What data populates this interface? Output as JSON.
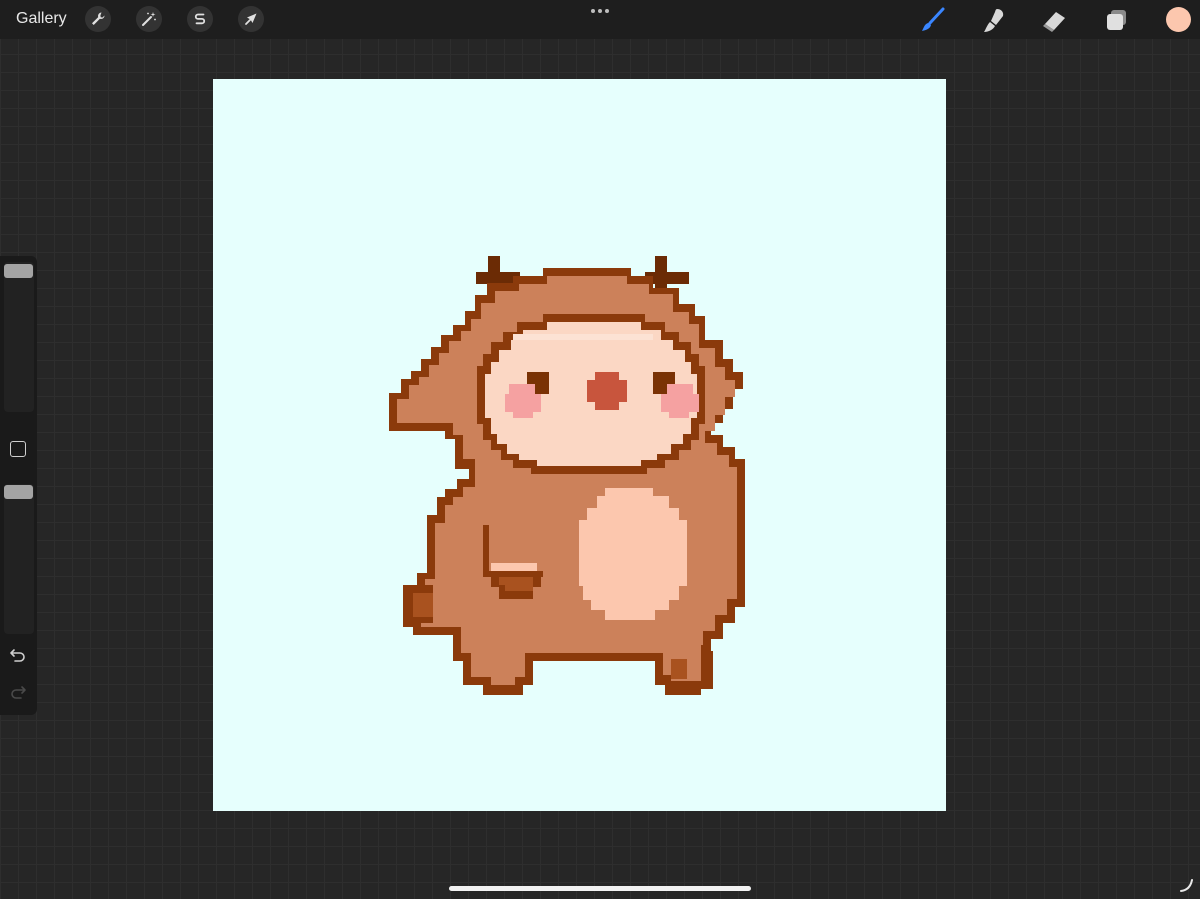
{
  "app": {
    "gallery_label": "Gallery"
  },
  "toolbar_left": [
    {
      "name": "actions",
      "icon": "wrench-icon"
    },
    {
      "name": "adjustments",
      "icon": "magic-wand-icon"
    },
    {
      "name": "selection",
      "icon": "selection-s-icon"
    },
    {
      "name": "transform",
      "icon": "arrow-cursor-icon"
    }
  ],
  "toolbar_right": [
    {
      "name": "brush",
      "icon": "brush-icon",
      "active": true
    },
    {
      "name": "smudge",
      "icon": "smudge-icon",
      "active": false
    },
    {
      "name": "eraser",
      "icon": "eraser-icon",
      "active": false
    },
    {
      "name": "layers",
      "icon": "layers-icon",
      "active": false
    }
  ],
  "colors": {
    "current_color": "#fcc7ae",
    "active_tool": "#3a86ff",
    "canvas_bg": "#e6fffd",
    "outline": "#8b3a0b",
    "fur": "#cc815a",
    "face": "#fbd7c4",
    "belly": "#fcc7ae",
    "blush": "#f5a1a1",
    "nose": "#c8553d",
    "antler": "#6b2b05"
  },
  "sidebar": {
    "brush_size_level": 0.0,
    "opacity_level": 0.0
  }
}
